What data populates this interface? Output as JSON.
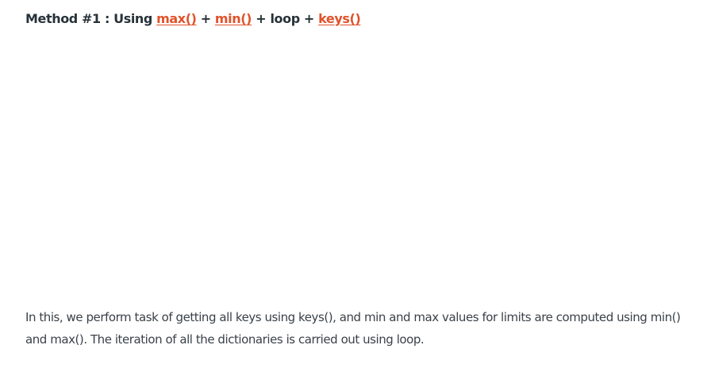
{
  "heading": {
    "prefix": "Method #1 : Using ",
    "link_max": "max()",
    "sep1": " + ",
    "link_min": "min()",
    "middle": " + loop + ",
    "link_keys": "keys()"
  },
  "paragraph": {
    "text": "In this, we perform task of getting all keys using keys(), and min and max values for limits are computed using min() and max(). The iteration of all the dictionaries is carried out using loop."
  },
  "colors": {
    "link": "#e0522a",
    "heading_text": "#273239",
    "body_text": "#3a4148",
    "background": "#ffffff"
  }
}
